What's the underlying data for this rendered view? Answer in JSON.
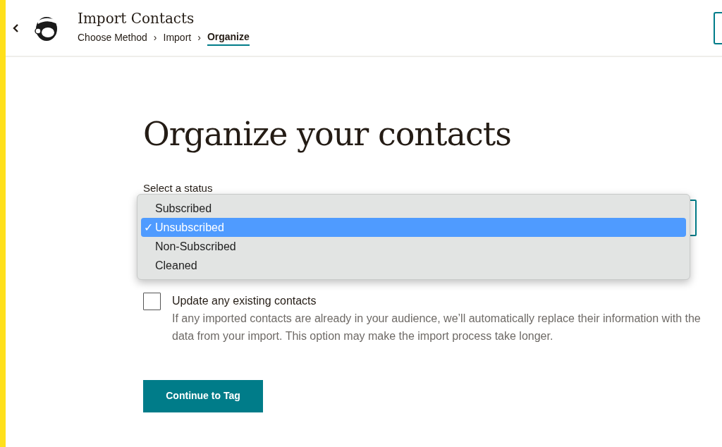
{
  "header": {
    "title": "Import Contacts",
    "breadcrumbs": [
      {
        "label": "Choose Method",
        "selected": false
      },
      {
        "label": "Import",
        "selected": false
      },
      {
        "label": "Organize",
        "selected": true
      }
    ],
    "separator": "›"
  },
  "heading": "Organize your contacts",
  "status_field": {
    "label": "Select a status",
    "options": [
      {
        "label": "Subscribed",
        "selected": false
      },
      {
        "label": "Unsubscribed",
        "selected": true
      },
      {
        "label": "Non-Subscribed",
        "selected": false
      },
      {
        "label": "Cleaned",
        "selected": false
      }
    ],
    "check": "✓"
  },
  "update_option": {
    "label": "Update any existing contacts",
    "checked": false,
    "description": "If any imported contacts are already in your audience, we’ll automatically replace their information with the data from your import. This option may make the import process take longer."
  },
  "continue_button": "Continue to Tag"
}
